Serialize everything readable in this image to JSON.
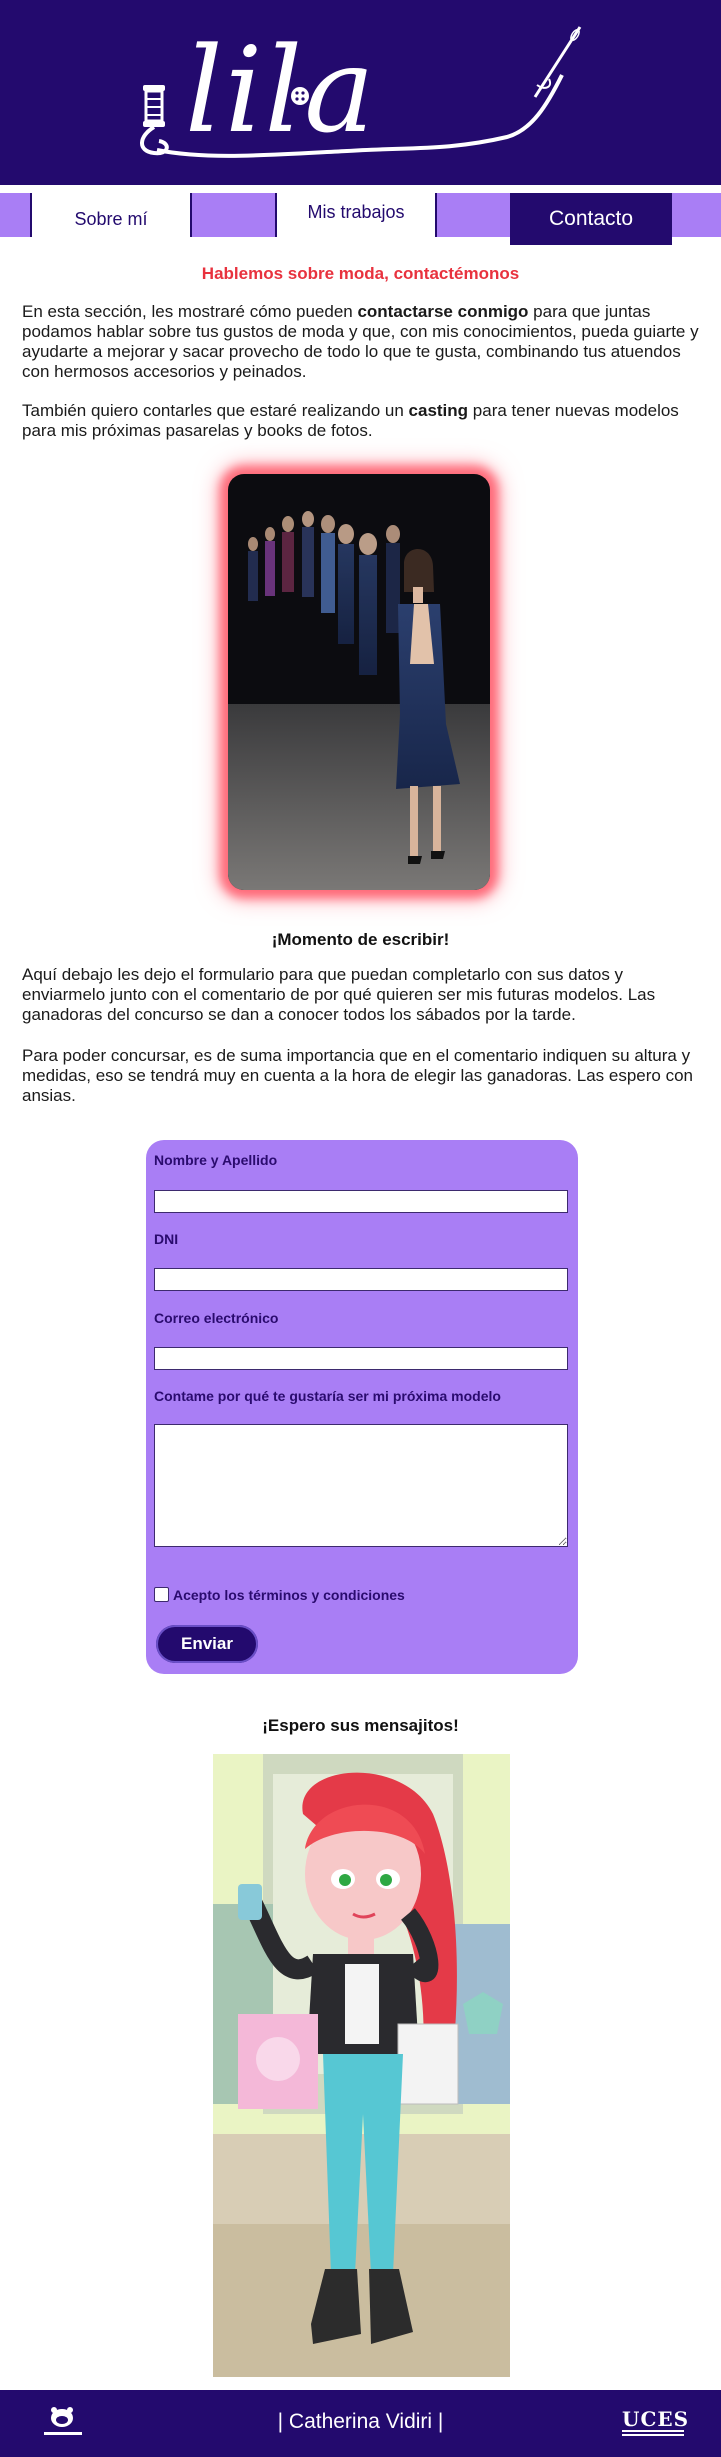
{
  "header": {
    "logo_text": "lila"
  },
  "nav": {
    "items": [
      {
        "label": "Sobre mí"
      },
      {
        "label": "Mis trabajos"
      },
      {
        "label": "Contacto"
      }
    ]
  },
  "intro": {
    "heading": "Hablemos sobre moda, contactémonos",
    "p1_a": "En esta sección, les mostraré cómo pueden ",
    "p1_b": "contactarse conmigo",
    "p1_c": " para que juntas podamos hablar sobre tus gustos de moda y que, con mis conocimientos, pueda guiarte y ayudarte a mejorar y sacar provecho de todo lo que te gusta, combinando tus atuendos con hermosos accesorios y peinados.",
    "p2_a": "También quiero contarles que estaré realizando un ",
    "p2_b": "casting",
    "p2_c": " para tener nuevas modelos para mis próximas pasarelas y books de fotos."
  },
  "write": {
    "heading": "¡Momento de escribir!",
    "p3": "Aquí debajo les dejo el formulario para que puedan completarlo con sus datos y enviarmelo junto con el comentario de por qué quieren ser mis futuras modelos. Las ganadoras del concurso se dan a conocer todos los sábados por la tarde.",
    "p4": "Para poder concursar, es de suma importancia que en el comentario indiquen su altura y medidas, eso se tendrá muy en cuenta a la hora de elegir las ganadoras. Las espero con ansias."
  },
  "form": {
    "name_label": "Nombre y Apellido",
    "name_value": "",
    "dni_label": "DNI",
    "dni_value": "",
    "email_label": "Correo electrónico",
    "email_value": "",
    "comment_label": "Contame por qué te gustaría ser mi próxima modelo",
    "comment_value": "",
    "terms_label": "Acepto los términos y condiciones",
    "submit_label": "Enviar"
  },
  "closing": {
    "heading": "¡Espero sus mensajitos!"
  },
  "footer": {
    "name": "| Catherina Vidiri |",
    "uces": "UCES"
  },
  "colors": {
    "brand_dark": "#230a6e",
    "brand_light": "#a97ef5",
    "accent_red": "#e8323e"
  }
}
